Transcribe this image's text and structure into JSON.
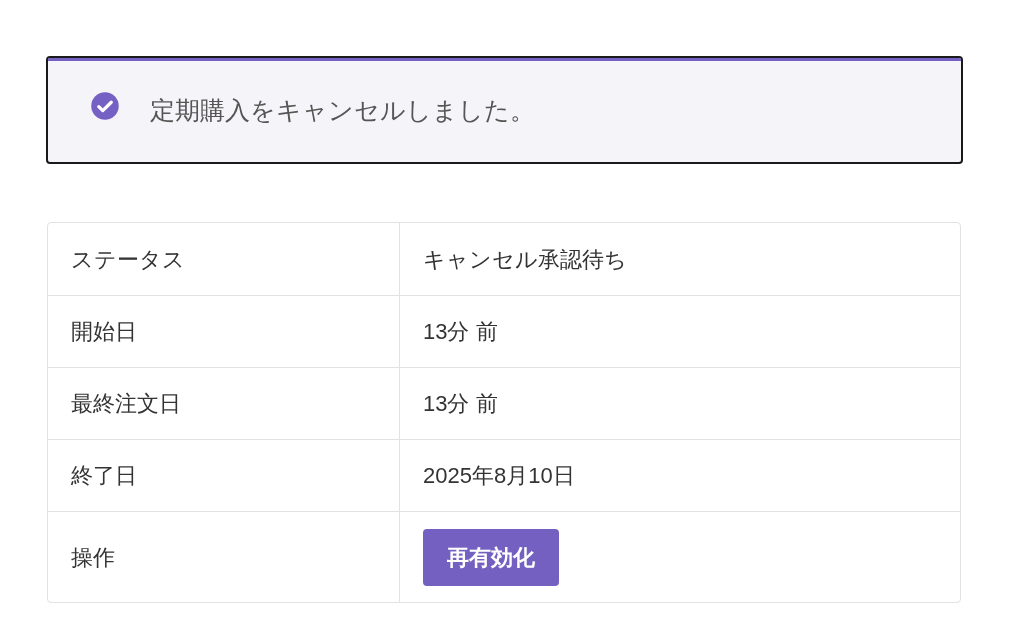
{
  "notice": {
    "message": "定期購入をキャンセルしました。"
  },
  "table": {
    "rows": [
      {
        "label": "ステータス",
        "kind": "text",
        "value": "キャンセル承認待ち"
      },
      {
        "label": "開始日",
        "kind": "text",
        "value": "13分 前"
      },
      {
        "label": "最終注文日",
        "kind": "text",
        "value": "13分 前"
      },
      {
        "label": "終了日",
        "kind": "text",
        "value": "2025年8月10日"
      },
      {
        "label": "操作",
        "kind": "button",
        "value": "再有効化"
      }
    ]
  }
}
